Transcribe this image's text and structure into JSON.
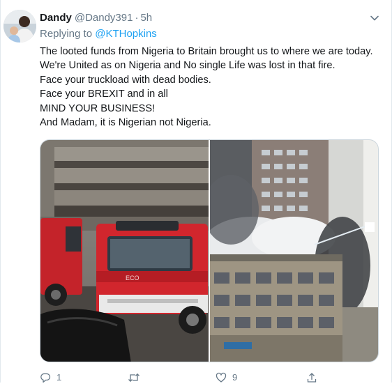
{
  "tweet": {
    "display_name": "Dandy",
    "handle": "@Dandy391",
    "separator": "·",
    "time": "5h",
    "replying_prefix": "Replying to",
    "replying_to": "@KTHopkins",
    "text_lines": [
      "The looted funds from Nigeria to Britain brought us to where we are today.",
      "We're United as on Nigeria and No single Life was lost in that fire.",
      "Face your truckload with dead bodies.",
      "Face your BREXIT and in all",
      "MIND YOUR BUSINESS!",
      "And Madam, it is Nigerian not Nigeria."
    ]
  },
  "actions": {
    "reply_count": "1",
    "retweet_count": "",
    "like_count": "9"
  },
  "icons": {
    "caret": "chevron-down-icon",
    "reply": "reply-icon",
    "retweet": "retweet-icon",
    "like": "heart-icon",
    "share": "share-icon"
  },
  "colors": {
    "link": "#1da1f2",
    "secondary_text": "#657786",
    "primary_text": "#14171a",
    "border": "#e1e8ed"
  }
}
